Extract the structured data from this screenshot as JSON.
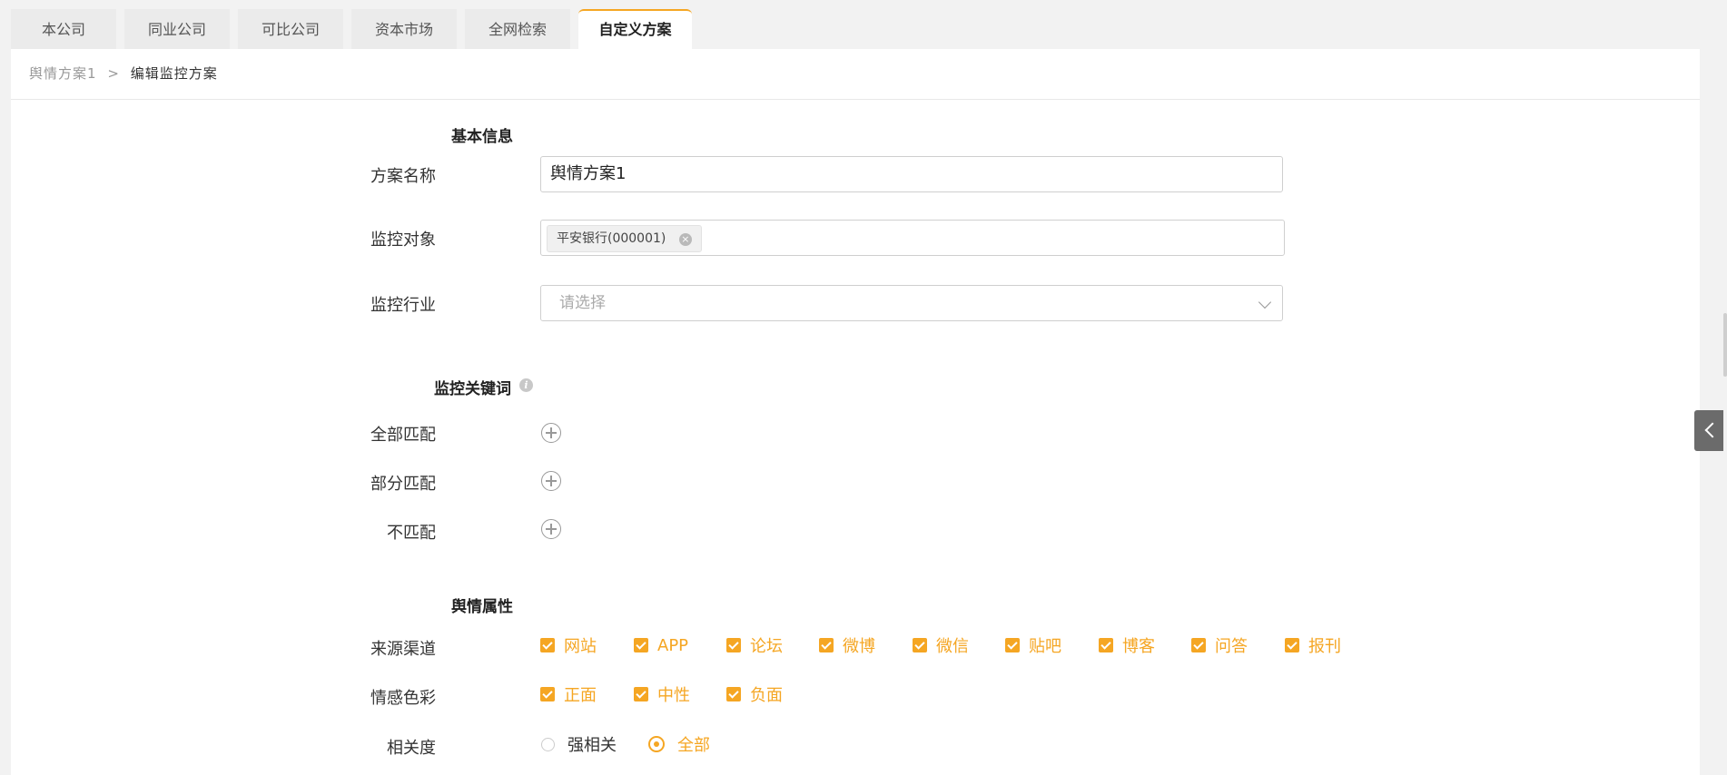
{
  "tabs": [
    {
      "label": "本公司",
      "active": false
    },
    {
      "label": "同业公司",
      "active": false
    },
    {
      "label": "可比公司",
      "active": false
    },
    {
      "label": "资本市场",
      "active": false
    },
    {
      "label": "全网检索",
      "active": false
    },
    {
      "label": "自定义方案",
      "active": true
    }
  ],
  "breadcrumb": {
    "parent": "舆情方案1",
    "separator": ">",
    "current": "编辑监控方案"
  },
  "basic_info": {
    "title": "基本信息",
    "name_label": "方案名称",
    "name_value": "舆情方案1",
    "target_label": "监控对象",
    "target_tag": "平安银行(000001)",
    "industry_label": "监控行业",
    "industry_placeholder": "请选择"
  },
  "keywords": {
    "title": "监控关键词",
    "all_match": "全部匹配",
    "partial_match": "部分匹配",
    "no_match": "不匹配"
  },
  "attributes": {
    "title": "舆情属性",
    "source_label": "来源渠道",
    "sources": [
      "网站",
      "APP",
      "论坛",
      "微博",
      "微信",
      "贴吧",
      "博客",
      "问答",
      "报刊"
    ],
    "sentiment_label": "情感色彩",
    "sentiments": [
      "正面",
      "中性",
      "负面"
    ],
    "relevance_label": "相关度",
    "relevance_options": [
      {
        "label": "强相关",
        "selected": false
      },
      {
        "label": "全部",
        "selected": true
      }
    ]
  },
  "colors": {
    "accent": "#f5a623"
  }
}
